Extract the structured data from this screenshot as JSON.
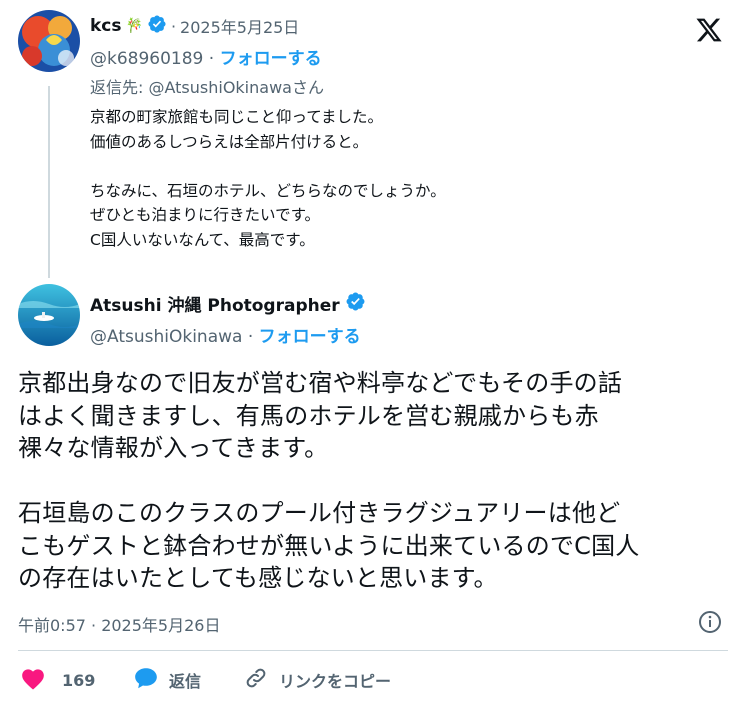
{
  "reply_tweet": {
    "display_name": "kcs",
    "name_emoji": "🎋",
    "date": "2025年5月25日",
    "handle": "@k68960189",
    "follow_label": "フォローする",
    "reply_to_prefix": "返信先: ",
    "reply_to_handle": "@AtsushiOkinawaさん",
    "body": "京都の町家旅館も同じこと仰ってました。\n価値のあるしつらえは全部片付けると。\n\nちなみに、石垣のホテル、どちらなのでしょうか。\nぜひとも泊まりに行きたいです。\nC国人いないなんて、最高です。"
  },
  "main_tweet": {
    "display_name": "Atsushi 沖縄 Photographer",
    "handle": "@AtsushiOkinawa",
    "follow_label": "フォローする",
    "body": "京都出身なので旧友が営む宿や料亭などでもその手の話\nはよく聞きますし、有馬のホテルを営む親戚からも赤\n裸々な情報が入ってきます。\n\n石垣島のこのクラスのプール付きラグジュアリーは他ど\nこもゲストと鉢合わせが無いように出来ているのでC国人\nの存在はいたとしても感じないと思います。",
    "timestamp": "午前0:57 · 2025年5月26日"
  },
  "actions": {
    "like_count": "169",
    "reply_label": "返信",
    "copy_link_label": "リンクをコピー"
  },
  "colors": {
    "accent": "#1d9bf0",
    "like": "#f91880",
    "muted": "#536471"
  },
  "icons": [
    "x-logo-icon",
    "verified-badge-icon",
    "heart-icon",
    "reply-bubble-icon",
    "link-icon",
    "info-icon"
  ]
}
